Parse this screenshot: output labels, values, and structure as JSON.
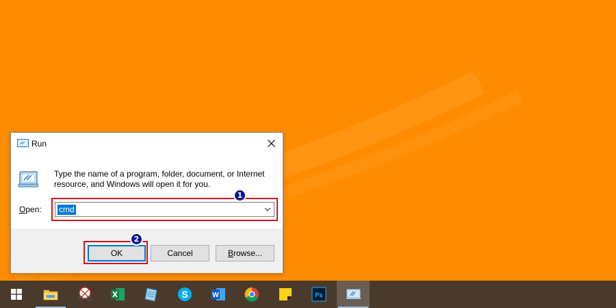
{
  "dialog": {
    "title": "Run",
    "description": "Type the name of a program, folder, document, or Internet resource, and Windows will open it for you.",
    "open_label_accel": "O",
    "open_label_rest": "pen:",
    "open_value": "cmd",
    "buttons": {
      "ok": "OK",
      "cancel": "Cancel",
      "browse_accel": "B",
      "browse_rest": "rowse..."
    }
  },
  "annotations": {
    "step1": "1",
    "step2": "2",
    "highlight_color": "#d6141c",
    "badge_color": "#0a1a8c"
  },
  "taskbar": {
    "items": [
      {
        "name": "start",
        "icon": "windows-logo-icon"
      },
      {
        "name": "file-explorer",
        "icon": "folder-icon"
      },
      {
        "name": "snipping-tool",
        "icon": "scissors-icon"
      },
      {
        "name": "excel",
        "icon": "excel-icon"
      },
      {
        "name": "notepad",
        "icon": "notepad-icon"
      },
      {
        "name": "skype",
        "icon": "skype-icon"
      },
      {
        "name": "word",
        "icon": "word-icon"
      },
      {
        "name": "chrome",
        "icon": "chrome-icon"
      },
      {
        "name": "sticky-notes",
        "icon": "sticky-notes-icon"
      },
      {
        "name": "photoshop",
        "icon": "photoshop-icon"
      },
      {
        "name": "run",
        "icon": "run-icon"
      }
    ]
  },
  "colors": {
    "desktop": "#FF8C00",
    "taskbar": "#4a3a2c",
    "selection": "#0078d7"
  }
}
